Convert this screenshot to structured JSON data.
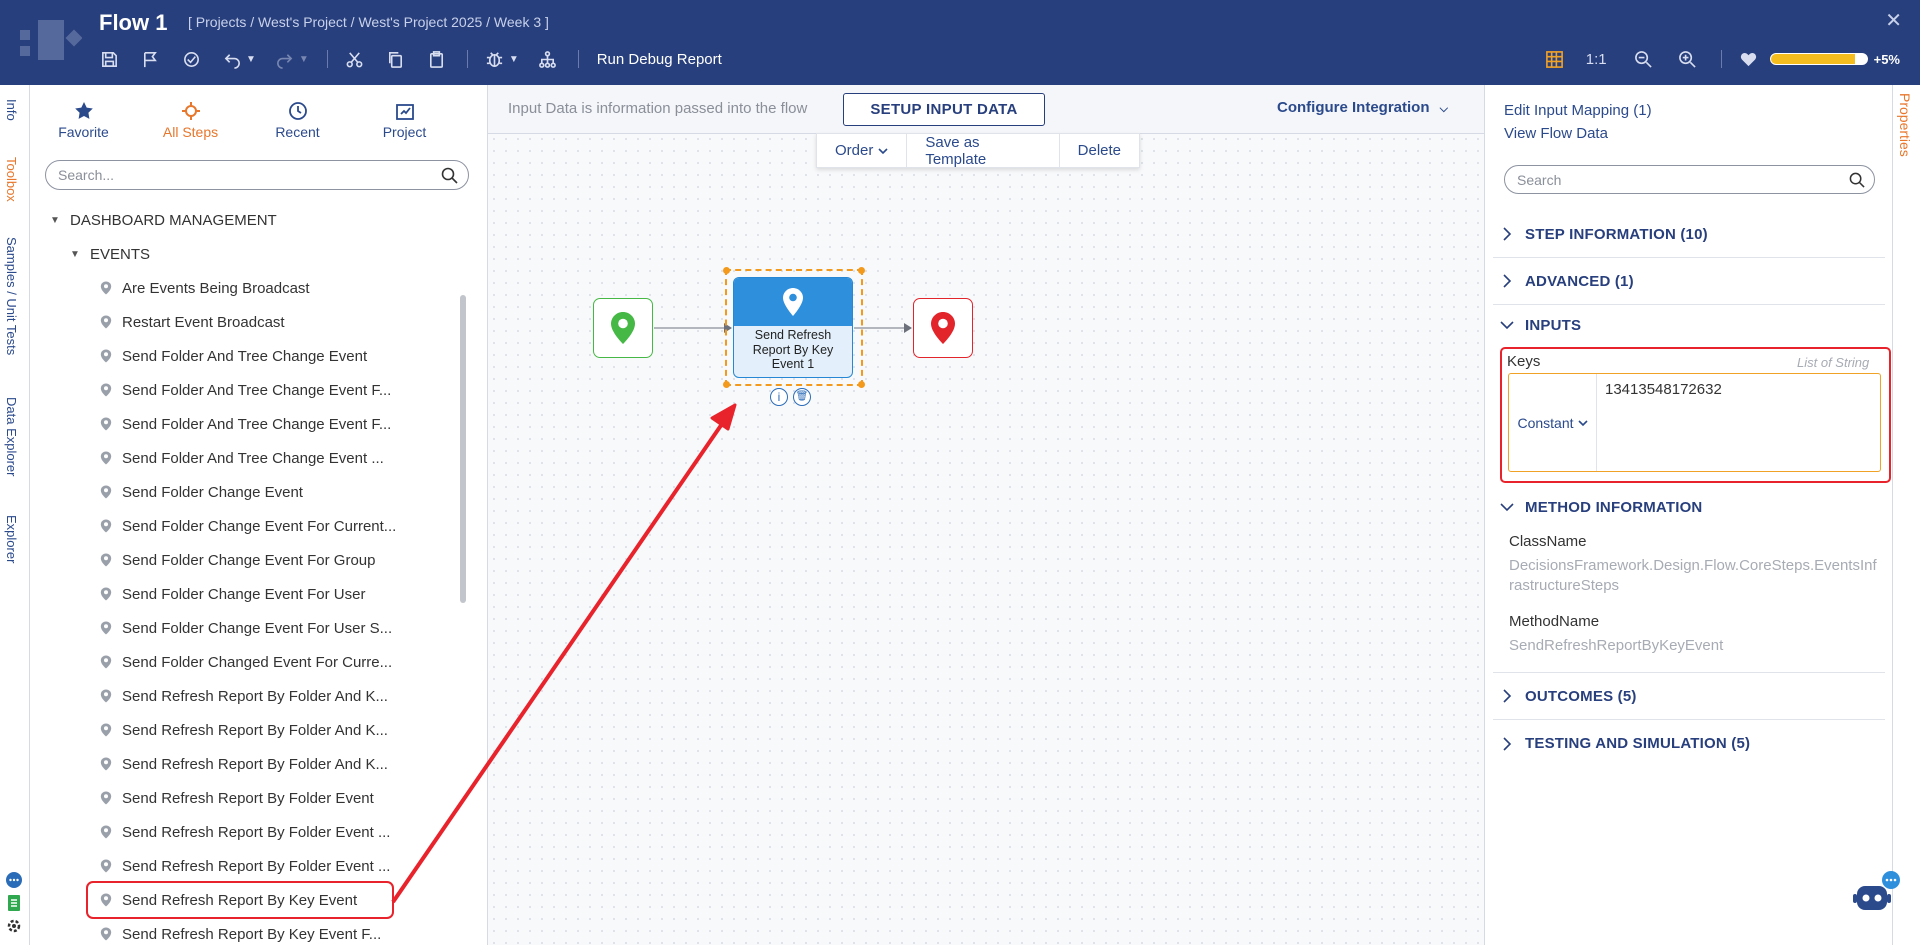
{
  "header": {
    "title": "Flow 1",
    "breadcrumb": "[ Projects / West's Project / West's Project 2025 / Week 3 ]",
    "close_icon": "✕",
    "run_debug_label": "Run Debug Report",
    "zoom_label": "1:1",
    "health_fraction": 0.88,
    "health_label": "+5%"
  },
  "left_tabs": [
    "Info",
    "Toolbox",
    "Samples / Unit Tests",
    "Data Explorer",
    "Explorer"
  ],
  "toolbox": {
    "tabs": [
      "Favorite",
      "All Steps",
      "Recent",
      "Project"
    ],
    "search_placeholder": "Search...",
    "group": "DASHBOARD MANAGEMENT",
    "subgroup": "EVENTS",
    "items": [
      "Are Events Being Broadcast",
      "Restart Event Broadcast",
      "Send Folder And Tree Change Event",
      "Send Folder And Tree Change Event F...",
      "Send Folder And Tree Change Event F...",
      "Send Folder And Tree Change Event ...",
      "Send Folder Change Event",
      "Send Folder Change Event For Current...",
      "Send Folder Change Event For Group",
      "Send Folder Change Event For User",
      "Send Folder Change Event For User S...",
      "Send Folder Changed Event For Curre...",
      "Send Refresh Report By Folder And K...",
      "Send Refresh Report By Folder And K...",
      "Send Refresh Report By Folder And K...",
      "Send Refresh Report By Folder Event",
      "Send Refresh Report By Folder Event ...",
      "Send Refresh Report By Folder Event ...",
      "Send Refresh Report By Key Event",
      "Send Refresh Report By Key Event F..."
    ]
  },
  "canvas": {
    "input_bar_text": "Input Data is information passed into the flow",
    "setup_button": "SETUP INPUT DATA",
    "configure_button": "Configure Integration",
    "context_menu": [
      "Order",
      "Save as Template",
      "Delete"
    ],
    "step_label": "Send Refresh Report By Key Event 1",
    "info_glyph": "i",
    "delete_glyph": "🗑"
  },
  "properties": {
    "tab_label": "Properties",
    "links": [
      "Edit Input Mapping (1)",
      "View Flow Data"
    ],
    "search_placeholder": "Search",
    "sections": [
      "STEP INFORMATION (10)",
      "ADVANCED (1)",
      "INPUTS",
      "METHOD INFORMATION",
      "OUTCOMES (5)",
      "TESTING AND SIMULATION (5)"
    ],
    "keys_label": "Keys",
    "keys_type": "List of String",
    "keys_mode": "Constant",
    "keys_value": "13413548172632",
    "class_name_label": "ClassName",
    "class_name_value": "DecisionsFramework.Design.Flow.CoreSteps.EventsInfrastructureSteps",
    "method_name_label": "MethodName",
    "method_name_value": "SendRefreshReportByKeyEvent"
  },
  "colors": {
    "header_bg": "#283f7d",
    "accent_orange": "#e8762b",
    "link_blue": "#2b4a8c",
    "highlight_red": "#e8232b",
    "start_green": "#46b845",
    "end_red": "#e2242b",
    "step_blue": "#2e8fdc"
  }
}
